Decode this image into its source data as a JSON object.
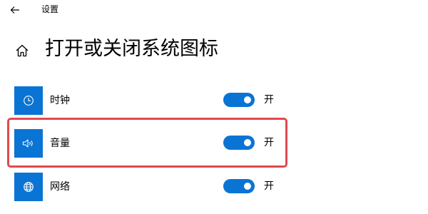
{
  "window": {
    "title": "设置",
    "back_icon": "arrow-left-icon"
  },
  "header": {
    "home_icon": "home-icon",
    "title": "打开或关闭系统图标"
  },
  "rows": [
    {
      "label": "时钟",
      "icon": "clock-icon",
      "state": "开",
      "on": true
    },
    {
      "label": "音量",
      "icon": "speaker-icon",
      "state": "开",
      "on": true,
      "highlighted": true
    },
    {
      "label": "网络",
      "icon": "globe-icon",
      "state": "开",
      "on": true
    }
  ],
  "colors": {
    "accent": "#0a74d4",
    "highlight": "#e0494f",
    "background": "#ffffff"
  }
}
